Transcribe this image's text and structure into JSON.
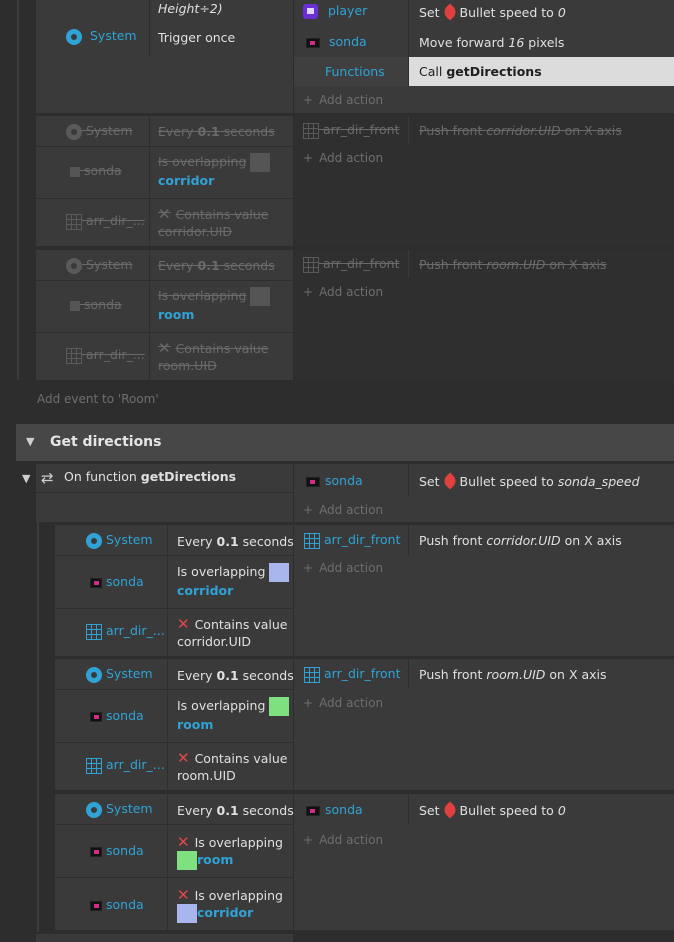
{
  "top_block": {
    "partial_cond_text": "Height÷2)",
    "system": "System",
    "trigger_once": "Trigger once",
    "actions": [
      {
        "obj": "player",
        "verb": "Set",
        "text": "Bullet speed to",
        "value": "0"
      },
      {
        "obj": "sonda",
        "text": "Move forward",
        "value": "16",
        "suffix": "pixels"
      },
      {
        "obj": "Functions",
        "verb": "Call",
        "value": "getDirections"
      }
    ],
    "add_action": "Add action"
  },
  "disabled_block_1": {
    "system": "System",
    "every": "Every",
    "every_value": "0.1",
    "every_unit": "seconds",
    "sonda": "sonda",
    "overlap": "Is overlapping",
    "overlap_obj": "corridor",
    "arr": "arr_dir_...",
    "contains": "Contains value",
    "contains_val": "corridor.UID",
    "action_obj": "arr_dir_front",
    "action_push": "Push front",
    "action_val": "corridor.UID",
    "action_axis": "on X axis",
    "add_action": "Add action"
  },
  "disabled_block_2": {
    "system": "System",
    "every": "Every",
    "every_value": "0.1",
    "every_unit": "seconds",
    "sonda": "sonda",
    "overlap": "Is overlapping",
    "overlap_obj": "room",
    "arr": "arr_dir_...",
    "contains": "Contains value",
    "contains_val": "room.UID",
    "action_obj": "arr_dir_front",
    "action_push": "Push front",
    "action_val": "room.UID",
    "action_axis": "on X axis",
    "add_action": "Add action"
  },
  "add_event": "Add event to 'Room'",
  "group": {
    "title": "Get directions",
    "func_label": "On function",
    "func_name": "getDirections",
    "func_action_obj": "sonda",
    "func_action_verb": "Set",
    "func_action_text": "Bullet speed to",
    "func_action_value": "sonda_speed",
    "add_action": "Add action"
  },
  "sub1": {
    "system": "System",
    "every": "Every",
    "every_value": "0.1",
    "every_unit": "seconds",
    "sonda": "sonda",
    "overlap": "Is overlapping",
    "overlap_obj": "corridor",
    "arr": "arr_dir_...",
    "contains": "Contains value",
    "contains_val": "corridor.UID",
    "action_obj": "arr_dir_front",
    "action_push": "Push front",
    "action_val": "corridor.UID",
    "action_axis": "on X axis",
    "add_action": "Add action"
  },
  "sub2": {
    "system": "System",
    "every": "Every",
    "every_value": "0.1",
    "every_unit": "seconds",
    "sonda": "sonda",
    "overlap": "Is overlapping",
    "overlap_obj": "room",
    "arr": "arr_dir_...",
    "contains": "Contains value",
    "contains_val": "room.UID",
    "action_obj": "arr_dir_front",
    "action_push": "Push front",
    "action_val": "room.UID",
    "action_axis": "on X axis",
    "add_action": "Add action"
  },
  "sub3": {
    "system": "System",
    "every": "Every",
    "every_value": "0.1",
    "every_unit": "seconds",
    "sonda1": "sonda",
    "overlap1": "Is overlapping",
    "overlap1_obj": "room",
    "sonda2": "sonda",
    "overlap2": "Is overlapping",
    "overlap2_obj": "corridor",
    "action_obj": "sonda",
    "action_verb": "Set",
    "action_text": "Bullet speed to",
    "action_value": "0",
    "add_action": "Add action"
  },
  "colors": {
    "accent": "#2fa3d6",
    "corridor_swatch": "#a9b6ee",
    "room_swatch": "#7fe07f",
    "invert_x": "#e04848"
  }
}
